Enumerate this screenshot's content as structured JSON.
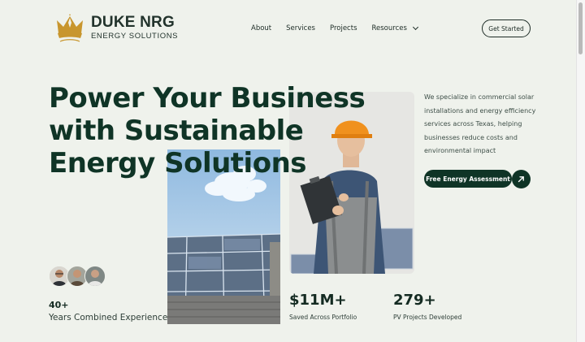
{
  "brand": {
    "name": "DUKE NRG",
    "tagline": "ENERGY SOLUTIONS",
    "color": "#c8962e"
  },
  "nav": {
    "items": [
      {
        "label": "About"
      },
      {
        "label": "Services"
      },
      {
        "label": "Projects"
      },
      {
        "label": "Resources",
        "has_dropdown": true
      }
    ],
    "cta_label": "Get Started"
  },
  "hero": {
    "headline": "Power Your Business with Sustainable Energy Solutions",
    "description": "We specialize in commercial solar installations and energy efficiency services across Texas, helping businesses reduce costs and environmental impact",
    "primary_button": "Free Energy Assessment",
    "arrow_icon": "arrow-up-right-icon"
  },
  "stats": [
    {
      "value": "40+",
      "label": "Years Combined Experience"
    },
    {
      "value": "$11M+",
      "label": "Saved Across Portfolio"
    },
    {
      "value": "279+",
      "label": "PV Projects Developed"
    }
  ],
  "colors": {
    "background": "#eff2ec",
    "primary": "#0f3426",
    "accent": "#c8962e"
  }
}
